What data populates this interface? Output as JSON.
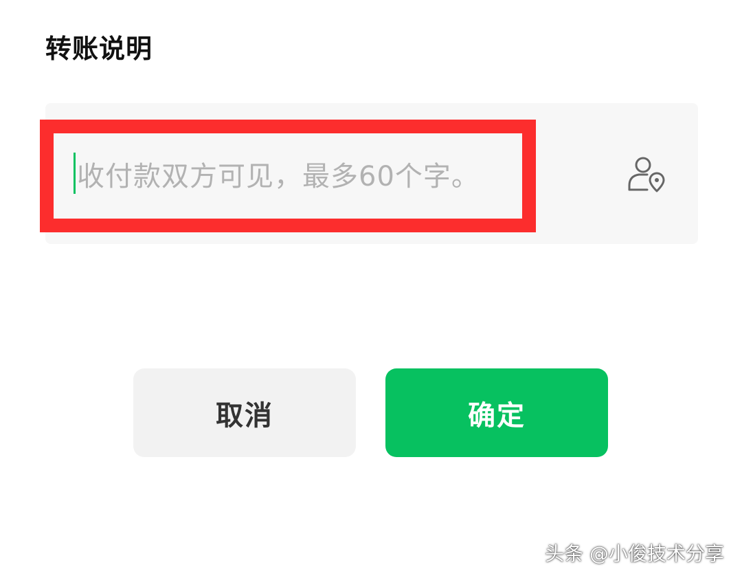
{
  "dialog": {
    "title": "转账说明",
    "input": {
      "placeholder": "收付款双方可见，最多60个字。",
      "value": ""
    },
    "icons": {
      "contact": "contact-location-icon"
    },
    "buttons": {
      "cancel_label": "取消",
      "confirm_label": "确定"
    }
  },
  "watermark": "头条 @小俊技术分享",
  "colors": {
    "accent": "#07c160",
    "highlight": "#fc2d2d",
    "input_bg": "#f7f7f7",
    "cancel_bg": "#f2f2f2",
    "placeholder": "#b2b2b2"
  }
}
